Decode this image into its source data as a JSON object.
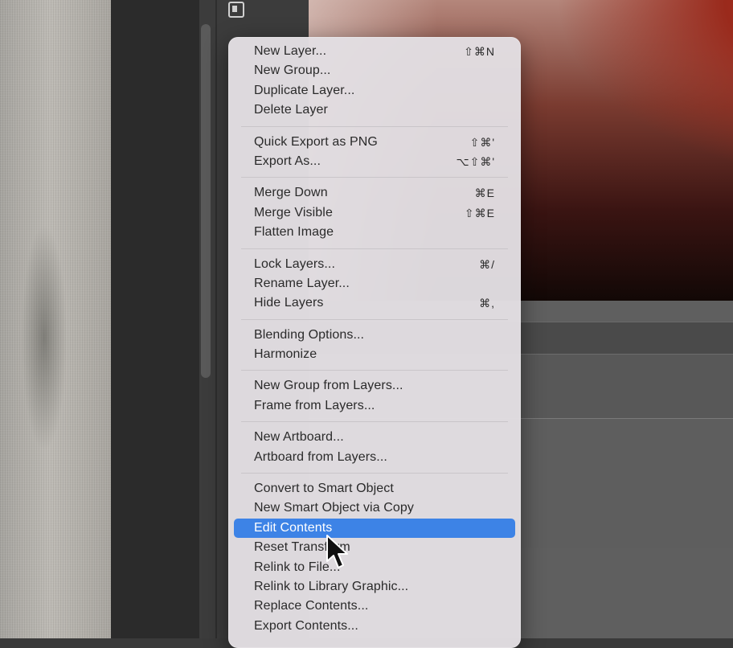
{
  "context_menu": {
    "groups": [
      [
        {
          "label": "New Layer...",
          "shortcut": "⇧⌘N"
        },
        {
          "label": "New Group...",
          "shortcut": ""
        },
        {
          "label": "Duplicate Layer...",
          "shortcut": ""
        },
        {
          "label": "Delete Layer",
          "shortcut": ""
        }
      ],
      [
        {
          "label": "Quick Export as PNG",
          "shortcut": "⇧⌘'"
        },
        {
          "label": "Export As...",
          "shortcut": "⌥⇧⌘'"
        }
      ],
      [
        {
          "label": "Merge Down",
          "shortcut": "⌘E"
        },
        {
          "label": "Merge Visible",
          "shortcut": "⇧⌘E"
        },
        {
          "label": "Flatten Image",
          "shortcut": ""
        }
      ],
      [
        {
          "label": "Lock Layers...",
          "shortcut": "⌘/"
        },
        {
          "label": "Rename Layer...",
          "shortcut": ""
        },
        {
          "label": "Hide Layers",
          "shortcut": "⌘,"
        }
      ],
      [
        {
          "label": "Blending Options...",
          "shortcut": ""
        },
        {
          "label": "Harmonize",
          "shortcut": ""
        }
      ],
      [
        {
          "label": "New Group from Layers...",
          "shortcut": ""
        },
        {
          "label": "Frame from Layers...",
          "shortcut": ""
        }
      ],
      [
        {
          "label": "New Artboard...",
          "shortcut": ""
        },
        {
          "label": "Artboard from Layers...",
          "shortcut": ""
        }
      ],
      [
        {
          "label": "Convert to Smart Object",
          "shortcut": ""
        },
        {
          "label": "New Smart Object via Copy",
          "shortcut": ""
        },
        {
          "label": "Edit Contents",
          "shortcut": "",
          "highlighted": true
        },
        {
          "label": "Reset Transform",
          "shortcut": ""
        },
        {
          "label": "Relink to File...",
          "shortcut": ""
        },
        {
          "label": "Relink to Library Graphic...",
          "shortcut": ""
        },
        {
          "label": "Replace Contents...",
          "shortcut": ""
        },
        {
          "label": "Export Contents...",
          "shortcut": ""
        }
      ]
    ]
  },
  "colors": {
    "highlight": "#3d83e6",
    "menu_bg": "#e2dee2"
  },
  "icons": {
    "panel_toggle": "panel-toggle-icon",
    "cursor": "mouse-pointer-icon"
  }
}
